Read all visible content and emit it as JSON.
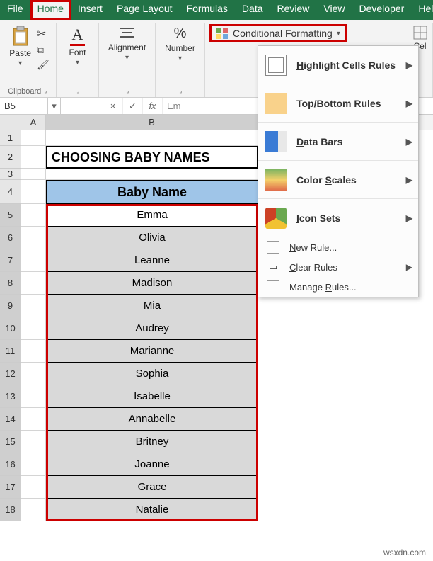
{
  "tabs": [
    "File",
    "Home",
    "Insert",
    "Page Layout",
    "Formulas",
    "Data",
    "Review",
    "View",
    "Developer",
    "Help"
  ],
  "active_tab": "Home",
  "ribbon": {
    "clipboard": {
      "label": "Clipboard",
      "paste": "Paste"
    },
    "font": {
      "label": "Font"
    },
    "alignment": {
      "label": "Alignment"
    },
    "number": {
      "label": "Number"
    },
    "cf": {
      "label": "Conditional Formatting"
    },
    "cells": {
      "label": "Cel"
    }
  },
  "namebox": "B5",
  "formula_placeholder": "Em",
  "fx_buttons": {
    "cancel": "×",
    "confirm": "✓",
    "fx": "fx"
  },
  "columns": [
    "A",
    "B"
  ],
  "title_text": "CHOOSING BABY NAMES",
  "header_text": "Baby Name",
  "rows": [
    {
      "n": 1,
      "v": ""
    },
    {
      "n": 2,
      "v": ""
    },
    {
      "n": 3,
      "v": ""
    },
    {
      "n": 4,
      "v": ""
    },
    {
      "n": 5,
      "v": "Emma"
    },
    {
      "n": 6,
      "v": "Olivia"
    },
    {
      "n": 7,
      "v": "Leanne"
    },
    {
      "n": 8,
      "v": "Madison"
    },
    {
      "n": 9,
      "v": "Mia"
    },
    {
      "n": 10,
      "v": "Audrey"
    },
    {
      "n": 11,
      "v": "Marianne"
    },
    {
      "n": 12,
      "v": "Sophia"
    },
    {
      "n": 13,
      "v": "Isabelle"
    },
    {
      "n": 14,
      "v": "Annabelle"
    },
    {
      "n": 15,
      "v": "Britney"
    },
    {
      "n": 16,
      "v": "Joanne"
    },
    {
      "n": 17,
      "v": "Grace"
    },
    {
      "n": 18,
      "v": "Natalie"
    }
  ],
  "menu": {
    "highlight": "Highlight Cells Rules",
    "topbottom": "Top/Bottom Rules",
    "databars": "Data Bars",
    "scales": "Color Scales",
    "iconsets": "Icon Sets",
    "newrule": "New Rule...",
    "clear": "Clear Rules",
    "manage": "Manage Rules..."
  },
  "watermark": "wsxdn.com"
}
